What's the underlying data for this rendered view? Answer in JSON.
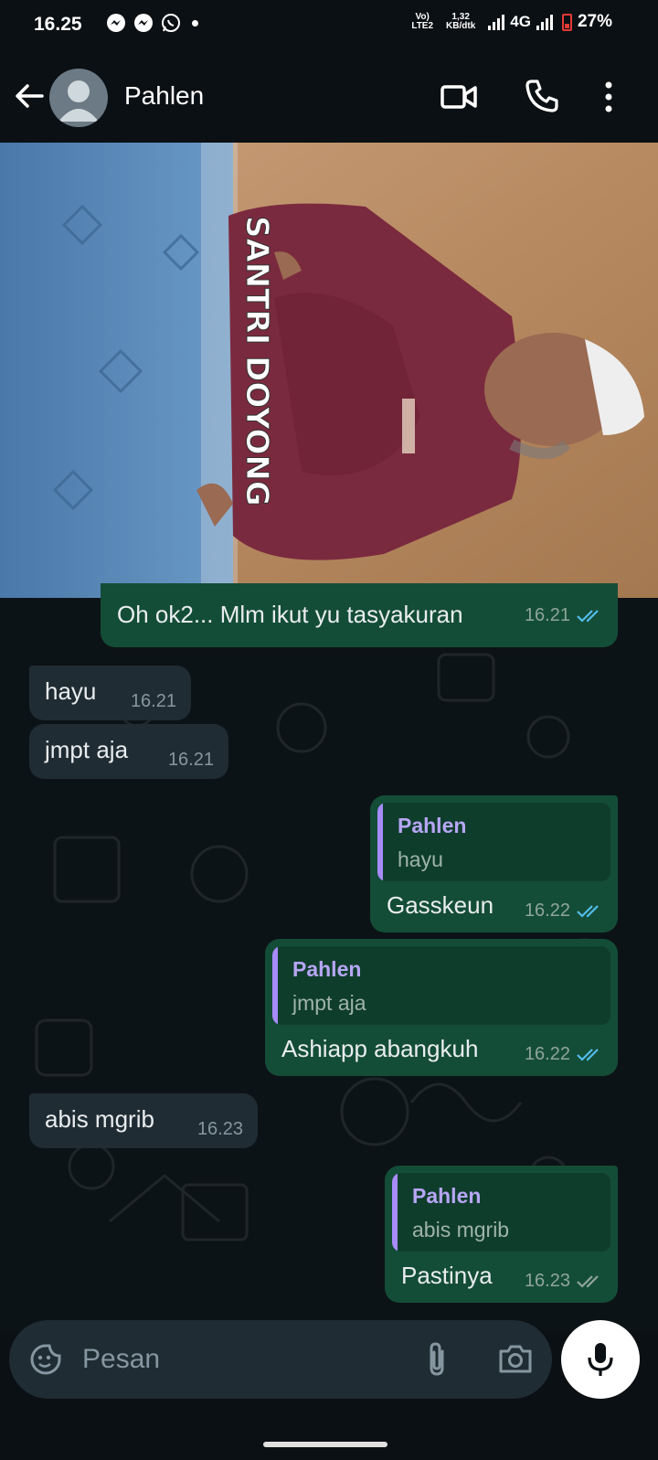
{
  "status_bar": {
    "time": "16.25",
    "volte": "Vo)",
    "lte": "LTE2",
    "speed_value": "1,32",
    "speed_unit": "KB/dtk",
    "network": "4G",
    "battery": "27%"
  },
  "header": {
    "contact_name": "Pahlen"
  },
  "image_caption": "SANTRI DOYONG",
  "messages": [
    {
      "dir": "out",
      "text": "Oh ok2... Mlm ikut yu tasyakuran",
      "time": "16.21",
      "status": "read"
    },
    {
      "dir": "in",
      "text": "hayu",
      "time": "16.21"
    },
    {
      "dir": "in",
      "text": "jmpt aja",
      "time": "16.21"
    },
    {
      "dir": "out",
      "quote_name": "Pahlen",
      "quote_text": "hayu",
      "text": "Gasskeun",
      "time": "16.22",
      "status": "read"
    },
    {
      "dir": "out",
      "quote_name": "Pahlen",
      "quote_text": "jmpt aja",
      "text": "Ashiapp abangkuh",
      "time": "16.22",
      "status": "read"
    },
    {
      "dir": "in",
      "text": "abis mgrib",
      "time": "16.23"
    },
    {
      "dir": "out",
      "quote_name": "Pahlen",
      "quote_text": "abis mgrib",
      "text": "Pastinya",
      "time": "16.23",
      "status": "delivered"
    }
  ],
  "input": {
    "placeholder": "Pesan"
  },
  "colors": {
    "background": "#0b1014",
    "outgoing_bubble": "#144d37",
    "incoming_bubble": "#202c33",
    "read_ticks": "#53bdeb",
    "quote_accent": "#a78bfa"
  }
}
